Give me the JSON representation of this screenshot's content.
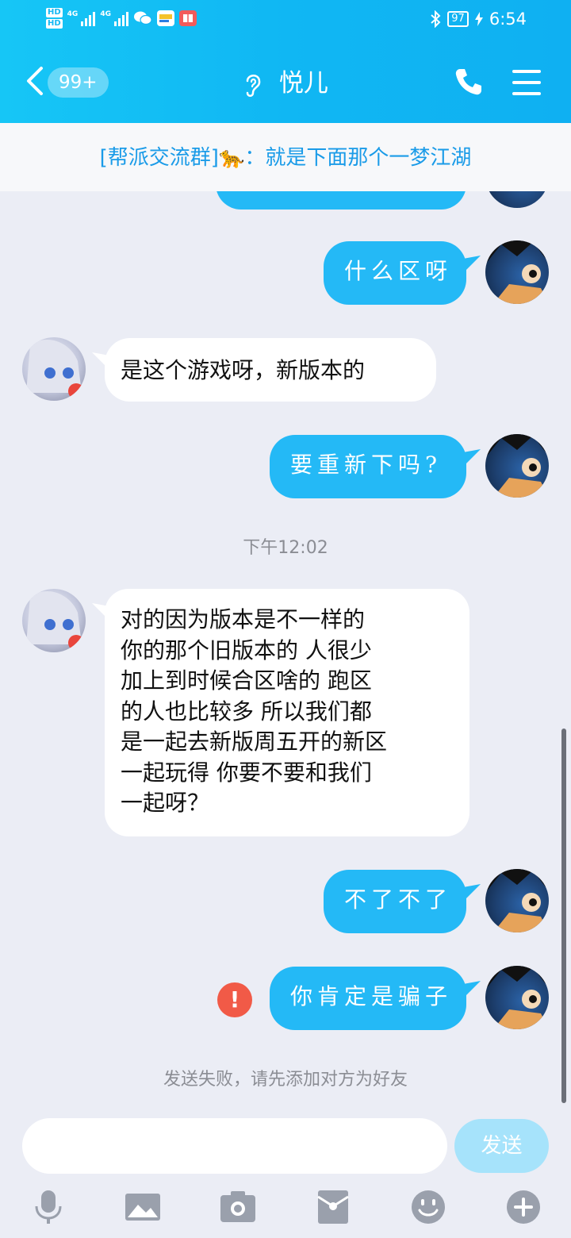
{
  "status_bar": {
    "hd1": "HD",
    "hd2": "HD",
    "net1": "4G",
    "net2": "4G",
    "battery": "97",
    "time": "6:54",
    "icons": [
      "bluetooth-icon",
      "battery-icon",
      "charging-icon",
      "wechat-icon",
      "message-icon",
      "book-icon"
    ]
  },
  "nav": {
    "unread_badge": "99+",
    "title": "悦儿",
    "icons": [
      "back-icon",
      "ear-icon",
      "phone-icon",
      "menu-icon"
    ]
  },
  "notice": {
    "text": "[帮派交流群]🐆：就是下面那个一梦江湖"
  },
  "messages": [
    {
      "side": "out",
      "text": "什么区呀"
    },
    {
      "side": "in",
      "text": "是这个游戏呀，新版本的"
    },
    {
      "side": "out",
      "text": "要重新下吗?"
    },
    {
      "type": "time",
      "text": "下午12:02"
    },
    {
      "side": "in",
      "lines": [
        "对的因为版本是不一样的",
        "你的那个旧版本的 人很少",
        "加上到时候合区啥的 跑区",
        "的人也比较多 所以我们都",
        "是一起去新版周五开的新区",
        "一起玩得 你要不要和我们",
        "一起呀？"
      ]
    },
    {
      "side": "out",
      "text": "不了不了"
    },
    {
      "side": "out",
      "text": "你肯定是骗子",
      "failed": true,
      "error_glyph": "!"
    },
    {
      "type": "system",
      "text": "发送失败，请先添加对方为好友"
    }
  ],
  "input": {
    "placeholder": "",
    "send_label": "发送"
  },
  "toolbar": [
    "microphone-icon",
    "image-icon",
    "camera-icon",
    "red-packet-icon",
    "emoji-icon",
    "plus-icon"
  ],
  "colors": {
    "header": "#10b7f3",
    "bubble_out": "#24b9f6",
    "bubble_in": "#ffffff",
    "background": "#ebedf5",
    "notice_text": "#1a9be8",
    "error": "#f15a47",
    "send_disabled": "#a6e3fb"
  }
}
